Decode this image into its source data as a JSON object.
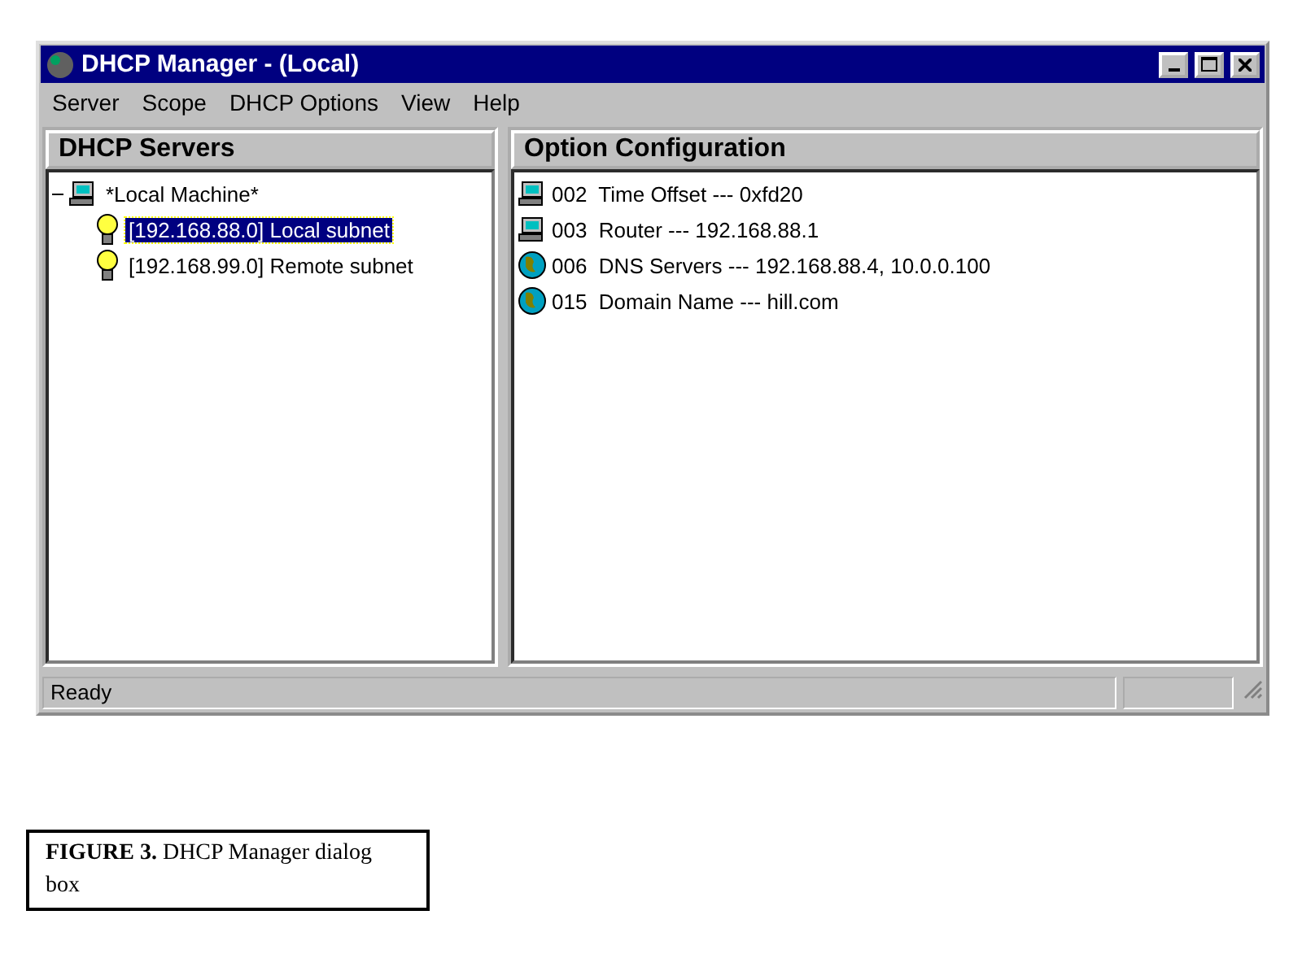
{
  "window": {
    "title": "DHCP Manager - (Local)"
  },
  "menu": [
    "Server",
    "Scope",
    "DHCP Options",
    "View",
    "Help"
  ],
  "servers_panel": {
    "title": "DHCP Servers",
    "tree": [
      {
        "label": "*Local Machine*",
        "kind": "computer",
        "expanded": true,
        "selected": false,
        "children": [
          {
            "label": "[192.168.88.0] Local subnet",
            "kind": "scope",
            "selected": true
          },
          {
            "label": "[192.168.99.0] Remote subnet",
            "kind": "scope",
            "selected": false
          }
        ]
      }
    ]
  },
  "options_panel": {
    "title": "Option Configuration",
    "items": [
      {
        "label": "002  Time Offset --- 0xfd20",
        "kind": "computer"
      },
      {
        "label": "003  Router --- 192.168.88.1",
        "kind": "computer"
      },
      {
        "label": "006  DNS Servers --- 192.168.88.4, 10.0.0.100",
        "kind": "globe"
      },
      {
        "label": "015  Domain Name --- hill.com",
        "kind": "globe"
      }
    ]
  },
  "status_bar": {
    "text": "Ready"
  },
  "caption": {
    "text": "**FIGURE 3.** DHCP Manager dialog box"
  }
}
